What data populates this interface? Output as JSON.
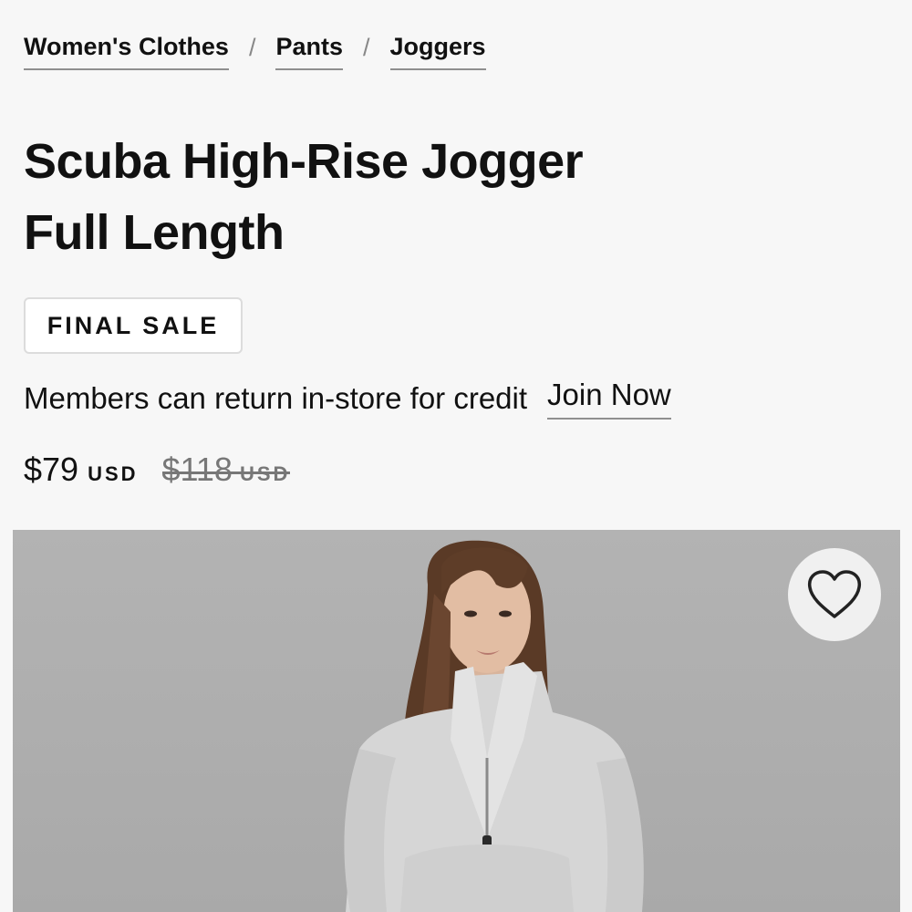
{
  "breadcrumb": {
    "items": [
      {
        "label": "Women's Clothes"
      },
      {
        "label": "Pants"
      },
      {
        "label": "Joggers"
      }
    ],
    "separator": "/"
  },
  "product": {
    "title_line1": "Scuba High-Rise Jogger",
    "title_line2": "Full Length",
    "badge": "FINAL SALE",
    "members_text": "Members can return in-store for credit",
    "join_label": "Join Now",
    "price": {
      "current": "$79",
      "current_currency": "USD",
      "original": "$118",
      "original_currency": "USD"
    }
  },
  "image": {
    "alt": "Model wearing light grey half-zip sweatshirt",
    "background_color": "#aeaeae"
  },
  "wishlist": {
    "icon": "heart-icon"
  }
}
